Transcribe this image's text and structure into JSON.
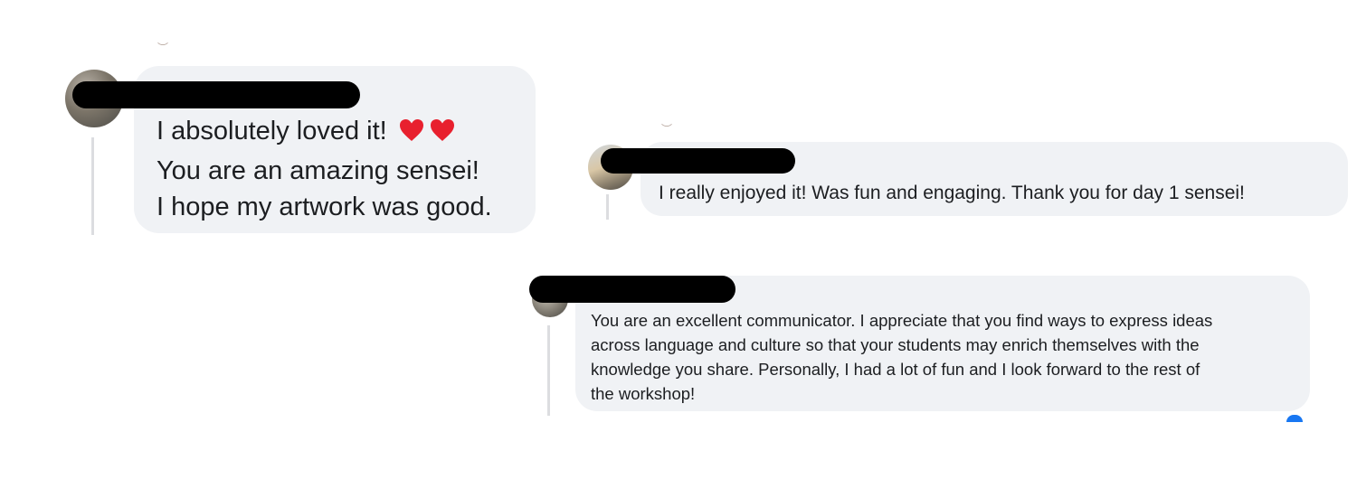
{
  "comments": [
    {
      "author_redacted": true,
      "lines": [
        "I absolutely loved it!",
        "You are an amazing sensei!",
        "I hope my artwork was good."
      ],
      "emoji": [
        "heart-icon",
        "heart-icon"
      ]
    },
    {
      "author_redacted": true,
      "text": "I really enjoyed it! Was fun and engaging. Thank you for day 1 sensei!"
    },
    {
      "author_redacted": true,
      "lines": [
        "You are an excellent communicator. I appreciate that you find ways to express ideas",
        "across language and culture so that your students may enrich themselves with the",
        "knowledge you share. Personally, I had a lot of fun and I look forward to the rest of",
        "the workshop!"
      ]
    }
  ],
  "colors": {
    "bubble": "#f0f2f5",
    "redaction": "#000000",
    "heart": "#e8202e",
    "thread_line": "#dcdde0",
    "accent": "#1877f2"
  }
}
